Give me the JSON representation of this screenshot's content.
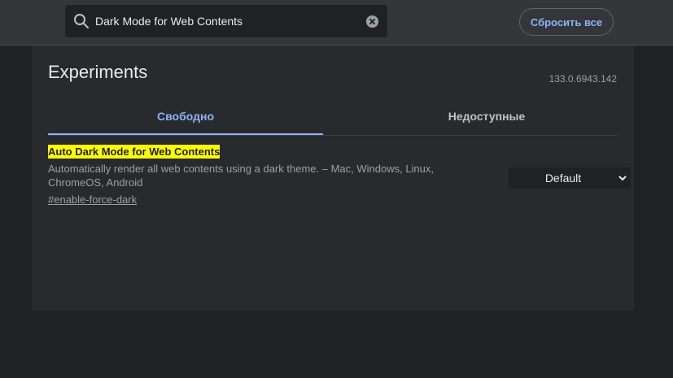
{
  "search": {
    "value": "Dark Mode for Web Contents",
    "icon": "search-icon",
    "clear_icon": "clear-icon"
  },
  "header": {
    "reset_label": "Сбросить все"
  },
  "main": {
    "title": "Experiments",
    "version": "133.0.6943.142",
    "tabs": [
      {
        "label": "Свободно",
        "active": true
      },
      {
        "label": "Недоступные",
        "active": false
      }
    ]
  },
  "experiment": {
    "name": "Auto Dark Mode for Web Contents",
    "description": "Automatically render all web contents using a dark theme. – Mac, Windows, Linux, ChromeOS, Android",
    "link": "#enable-force-dark",
    "selected": "Default"
  },
  "colors": {
    "background": "#202124",
    "panel": "#292a2d",
    "accent": "#8ab4f8",
    "highlight": "#ffff00"
  }
}
